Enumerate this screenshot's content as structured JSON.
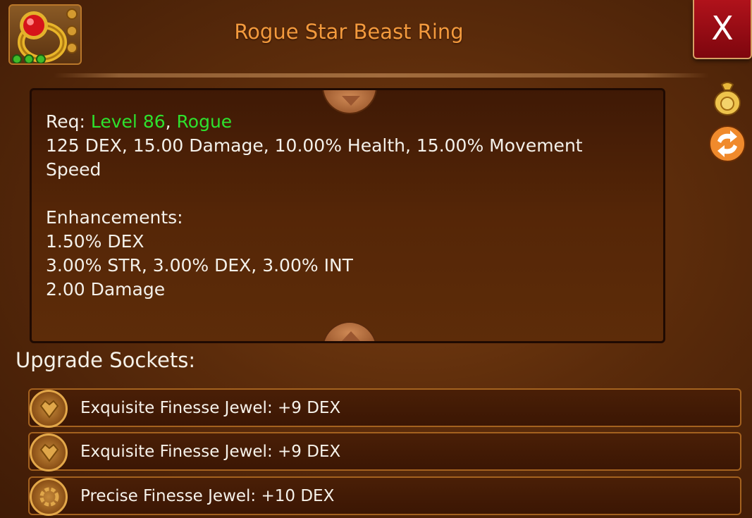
{
  "header": {
    "title": "Rogue Star Beast Ring",
    "close_label": "X"
  },
  "description": {
    "req_prefix": "Req: ",
    "req_level": "Level 86",
    "req_sep": ", ",
    "req_class": "Rogue",
    "stats_line1": "125 DEX, 15.00 Damage, 10.00% Health, 15.00% Movement",
    "stats_line2": "Speed",
    "enhancements_label": "Enhancements:",
    "enhancements": [
      "1.50% DEX",
      "3.00% STR, 3.00% DEX, 3.00% INT",
      "2.00 Damage"
    ]
  },
  "sockets": {
    "title": "Upgrade Sockets:",
    "items": [
      {
        "label": "Exquisite Finesse Jewel: +9 DEX"
      },
      {
        "label": "Exquisite Finesse Jewel: +9 DEX"
      },
      {
        "label": "Precise Finesse Jewel: +10 DEX"
      }
    ]
  },
  "colors": {
    "title": "#f39a3d",
    "requirement": "#2ee22e",
    "close": "#b0121b"
  },
  "icons": {
    "item": "ring-icon",
    "sell": "money-bag-icon",
    "swap": "swap-arrows-icon",
    "scroll_up": "triangle-up-icon",
    "scroll_down": "triangle-down-icon",
    "socket": "jewel-icon"
  }
}
